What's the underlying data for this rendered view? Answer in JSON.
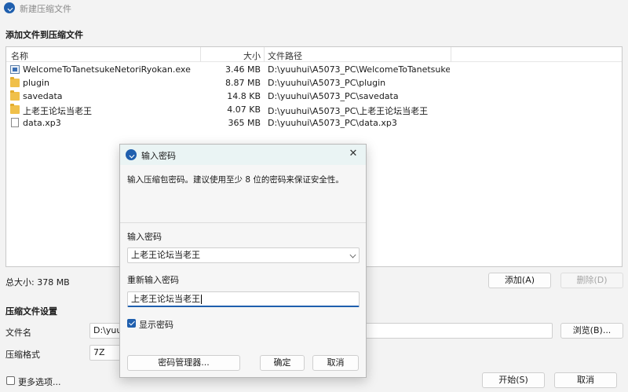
{
  "window": {
    "title": "新建压缩文件"
  },
  "add_section": {
    "title": "添加文件到压缩文件"
  },
  "file_list": {
    "columns": {
      "name": "名称",
      "size": "大小",
      "path": "文件路径"
    },
    "rows": [
      {
        "icon": "exe-icon",
        "name": "WelcomeToTanetsukeNetoriRyokan.exe",
        "size": "3.46 MB",
        "path": "D:\\yuuhui\\A5073_PC\\WelcomeToTanetsukeNet..."
      },
      {
        "icon": "folder-icon",
        "name": "plugin",
        "size": "8.87 MB",
        "path": "D:\\yuuhui\\A5073_PC\\plugin"
      },
      {
        "icon": "folder-icon",
        "name": "savedata",
        "size": "14.8 KB",
        "path": "D:\\yuuhui\\A5073_PC\\savedata"
      },
      {
        "icon": "folder-icon",
        "name": "上老王论坛当老王",
        "size": "4.07 KB",
        "path": "D:\\yuuhui\\A5073_PC\\上老王论坛当老王"
      },
      {
        "icon": "file-icon",
        "name": "data.xp3",
        "size": "365 MB",
        "path": "D:\\yuuhui\\A5073_PC\\data.xp3"
      }
    ]
  },
  "total_size": "总大小: 378 MB",
  "buttons": {
    "add": "添加(A)",
    "delete": "删除(D)",
    "browse": "浏览(B)...",
    "start": "开始(S)",
    "cancel": "取消"
  },
  "settings": {
    "title": "压缩文件设置",
    "filename_label": "文件名",
    "filename_value": "D:\\yuuh",
    "format_label": "压缩格式",
    "format_value": "7Z"
  },
  "more_options": "更多选项...",
  "password_dialog": {
    "title": "输入密码",
    "description": "输入压缩包密码。建议使用至少 8 位的密码来保证安全性。",
    "password_label": "输入密码",
    "password_value": "上老王论坛当老王",
    "confirm_label": "重新输入密码",
    "confirm_value": "上老王论坛当老王",
    "show_password": "显示密码",
    "show_password_checked": true,
    "manager_button": "密码管理器...",
    "ok_button": "确定",
    "cancel_button": "取消",
    "close_glyph": "✕"
  },
  "colors": {
    "accent": "#1f5fae",
    "dialog_title_bg": "#eaf4f4"
  }
}
